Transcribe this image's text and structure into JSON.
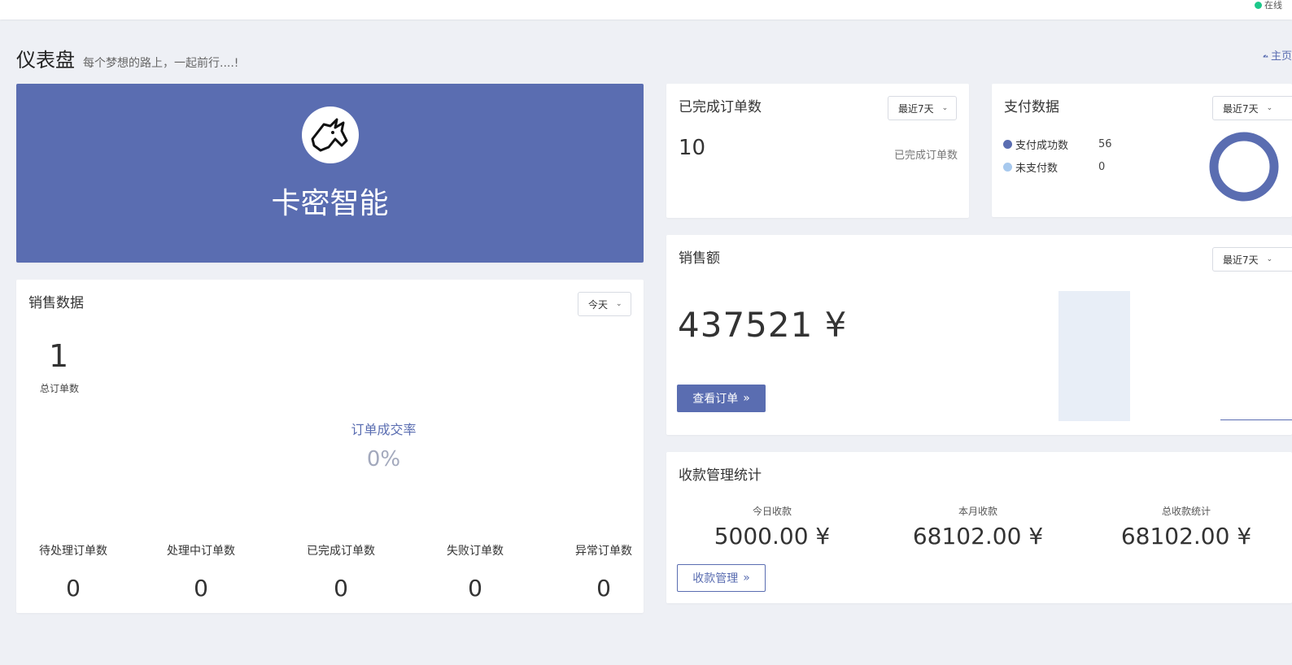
{
  "topbar": {
    "status_text": "在线",
    "status_color": "#1cc88a"
  },
  "page": {
    "title": "仪表盘",
    "subtitle": "每个梦想的路上，一起前行....!",
    "home_link": "主页"
  },
  "brand": {
    "name": "卡密智能",
    "bg_color": "#5a6db1",
    "logo_icon": "unicorn-icon"
  },
  "sales": {
    "title": "销售数据",
    "range": "今天",
    "total_orders": "1",
    "total_orders_label": "总订单数",
    "rate_label": "订单成交率",
    "rate_value": "0%",
    "stats": [
      {
        "label": "待处理订单数",
        "value": "0"
      },
      {
        "label": "处理中订单数",
        "value": "0"
      },
      {
        "label": "已完成订单数",
        "value": "0"
      },
      {
        "label": "失败订单数",
        "value": "0"
      },
      {
        "label": "异常订单数",
        "value": "0"
      }
    ]
  },
  "completed": {
    "title": "已完成订单数",
    "range": "最近7天",
    "value": "10",
    "label": "已完成订单数"
  },
  "payment": {
    "title": "支付数据",
    "range": "最近7天",
    "legend": [
      {
        "label": "支付成功数",
        "value": "56",
        "color": "#5a6db1"
      },
      {
        "label": "未支付数",
        "value": "0",
        "color": "#a7c9ee"
      }
    ],
    "chart_data": {
      "type": "pie",
      "categories": [
        "支付成功数",
        "未支付数"
      ],
      "values": [
        56,
        0
      ]
    }
  },
  "revenue": {
    "title": "销售额",
    "range": "最近7天",
    "value": "437521 ¥",
    "button_label": "查看订单",
    "button_icon": "double-chevron-right-icon"
  },
  "collection": {
    "title": "收款管理统计",
    "items": [
      {
        "label": "今日收款",
        "value": "5000.00 ¥"
      },
      {
        "label": "本月收款",
        "value": "68102.00 ¥"
      },
      {
        "label": "总收款统计",
        "value": "68102.00 ¥"
      }
    ],
    "button_label": "收款管理",
    "button_icon": "double-chevron-right-icon"
  }
}
